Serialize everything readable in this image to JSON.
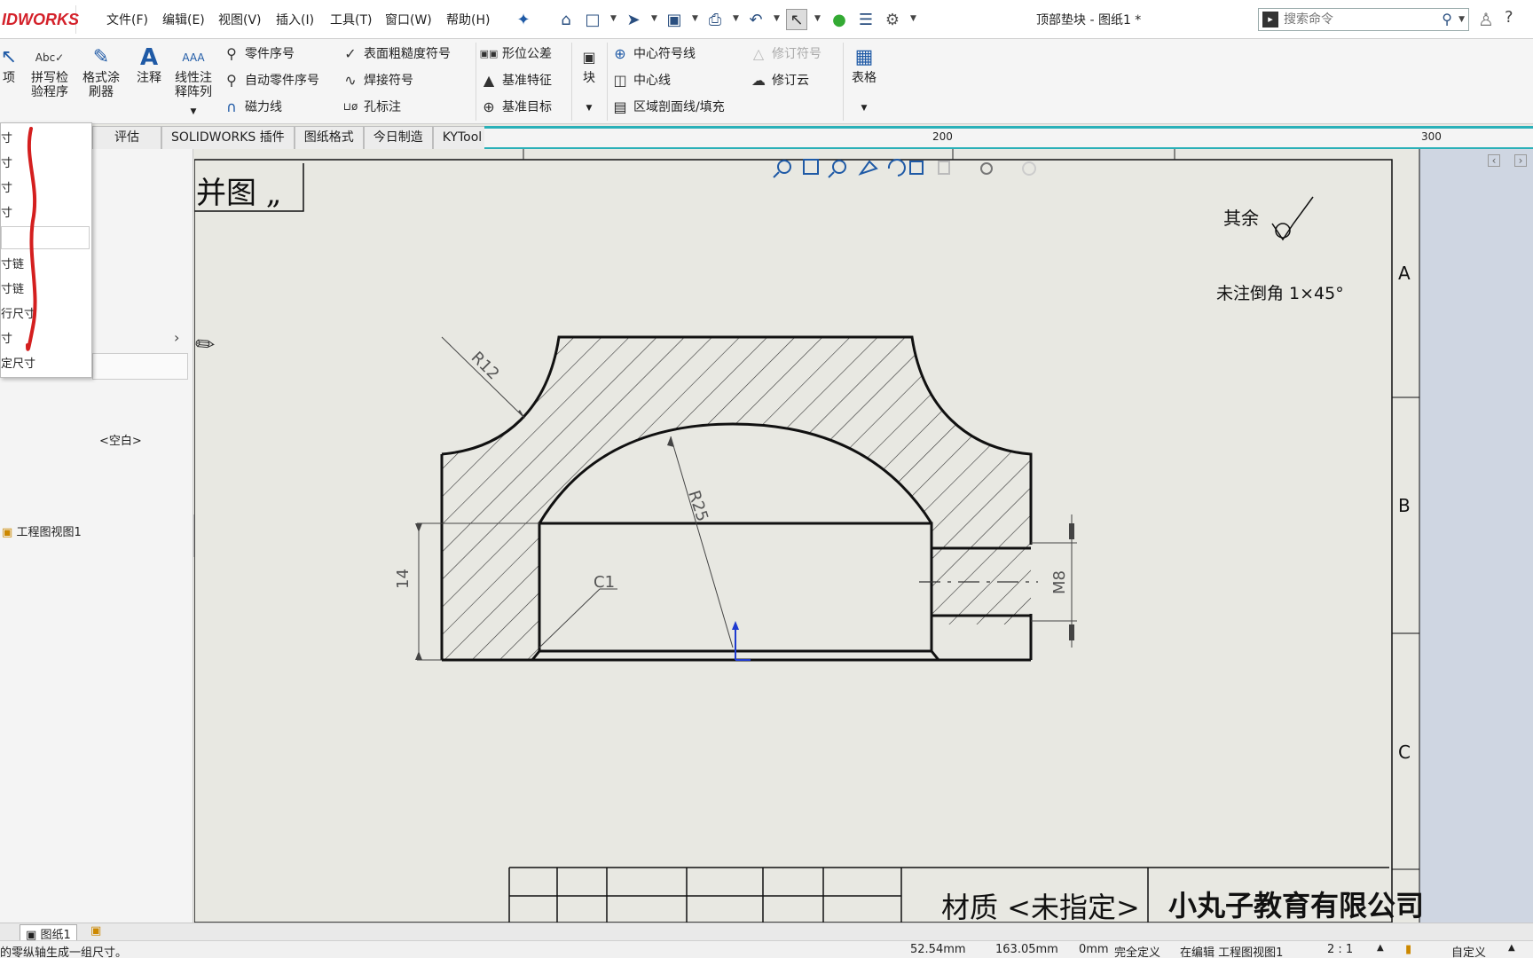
{
  "app": {
    "logo_text": "IDWORKS",
    "document_title": "顶部垫块 - 图纸1 *"
  },
  "menu": [
    "文件(F)",
    "编辑(E)",
    "视图(V)",
    "插入(I)",
    "工具(T)",
    "窗口(W)",
    "帮助(H)"
  ],
  "search": {
    "placeholder": "搜索命令"
  },
  "ribbon": {
    "cut_item": "项",
    "spell_check": [
      "拼写检",
      "验程序"
    ],
    "format_painter": [
      "格式涂",
      "刷器"
    ],
    "note": "注释",
    "linear_note_pattern": [
      "线性注",
      "释阵列"
    ],
    "balloon": "零件序号",
    "auto_balloon": "自动零件序号",
    "magnetic_line": "磁力线",
    "surface_finish": "表面粗糙度符号",
    "weld_symbol": "焊接符号",
    "hole_callout": "孔标注",
    "geometric_tolerance": "形位公差",
    "datum_feature": "基准特征",
    "datum_target": "基准目标",
    "block": "块",
    "center_mark": "中心符号线",
    "centerline": "中心线",
    "area_hatch": "区域剖面线/填充",
    "revision_symbol": "修订符号",
    "revision_cloud": "修订云",
    "table": "表格"
  },
  "tabs": [
    "评估",
    "SOLIDWORKS 插件",
    "图纸格式",
    "今日制造",
    "KYTool"
  ],
  "ruler": {
    "label_200": "200",
    "label_300": "300"
  },
  "left_panel": {
    "popup_items": [
      "寸",
      "寸",
      "寸",
      "寸",
      "",
      "寸链",
      "寸链",
      "行尺寸",
      "寸",
      "定尺寸"
    ],
    "empty_value": "<空白>",
    "tree_item": "工程图视图1"
  },
  "drawing": {
    "title_fragment": "并图 „",
    "surface_note": "其余",
    "chamfer_note": "未注倒角   1×45°",
    "dim_r12": "R12",
    "dim_r25": "R25",
    "dim_c1": "C1",
    "dim_14": "14",
    "dim_m8": "M8",
    "zone_a": "A",
    "zone_b": "B",
    "zone_c": "C",
    "material": "材质 <未指定>",
    "company": "小丸子教育有限公司"
  },
  "sheet_tabs": [
    "图纸1"
  ],
  "status": {
    "hint": "的零纵轴生成一组尺寸。",
    "x": "52.54mm",
    "y": "163.05mm",
    "z": "0mm",
    "state": "完全定义",
    "editing": "在编辑 工程图视图1",
    "scale": "2 : 1",
    "custom": "自定义"
  }
}
